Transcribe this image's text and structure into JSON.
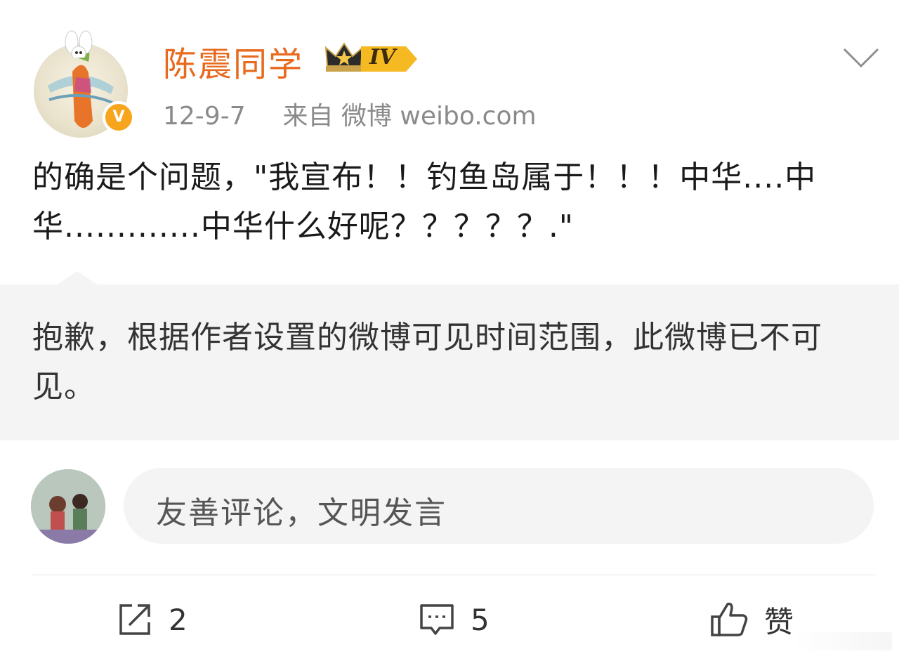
{
  "author": {
    "name": "陈震同学",
    "level_badge": "IV",
    "verified_mark": "V"
  },
  "post": {
    "date": "12-9-7",
    "source": "来自 微博 weibo.com",
    "text": "的确是个问题，\"我宣布！！钓鱼岛属于！！！中华....中华.............中华什么好呢？？？？？.\""
  },
  "notice": {
    "text": "抱歉，根据作者设置的微博可见时间范围，此微博已不可见。"
  },
  "comment_box": {
    "placeholder": "友善评论，文明发言"
  },
  "actions": {
    "repost_count": "2",
    "comment_count": "5",
    "like_label": "赞"
  },
  "colors": {
    "username": "#e86a1e",
    "verified": "#f7a51c",
    "muted": "#8a8a8a",
    "notice_bg": "#f4f4f4"
  },
  "icons": [
    "more-chevron-icon",
    "crown-icon",
    "repost-icon",
    "comment-icon",
    "like-icon"
  ]
}
